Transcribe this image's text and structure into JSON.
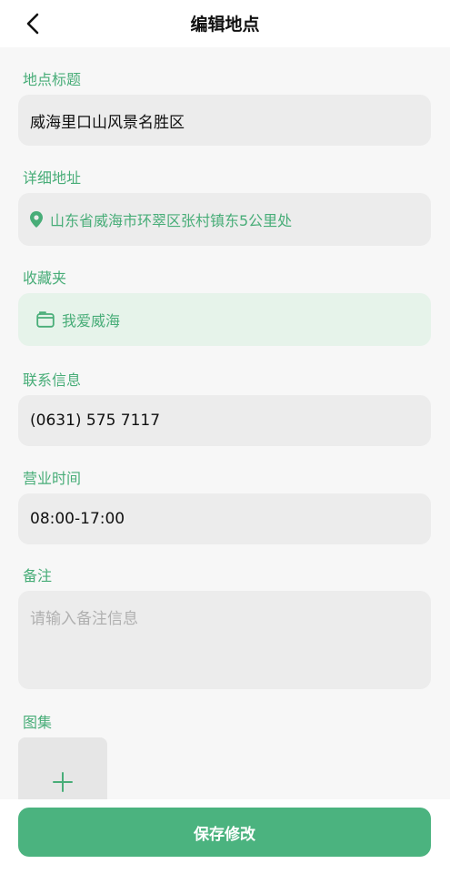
{
  "header": {
    "title": "编辑地点",
    "back_icon": "chevron-left-icon"
  },
  "form": {
    "title_label": "地点标题",
    "title_value": "威海里口山风景名胜区",
    "address_label": "详细地址",
    "address_value": "山东省威海市环翠区张村镇东5公里处",
    "address_icon": "location-pin-icon",
    "folder_label": "收藏夹",
    "folder_value": "我爱威海",
    "folder_icon": "folder-icon",
    "contact_label": "联系信息",
    "contact_value": "(0631) 575 7117",
    "hours_label": "营业时间",
    "hours_value": "08:00-17:00",
    "notes_label": "备注",
    "notes_placeholder": "请输入备注信息",
    "gallery_label": "图集",
    "gallery_add_icon": "plus-icon"
  },
  "footer": {
    "save_label": "保存修改"
  },
  "colors": {
    "accent": "#4bb37f",
    "label": "#48ad78",
    "field_bg": "#ececec",
    "folder_bg": "#e6f3ea"
  }
}
